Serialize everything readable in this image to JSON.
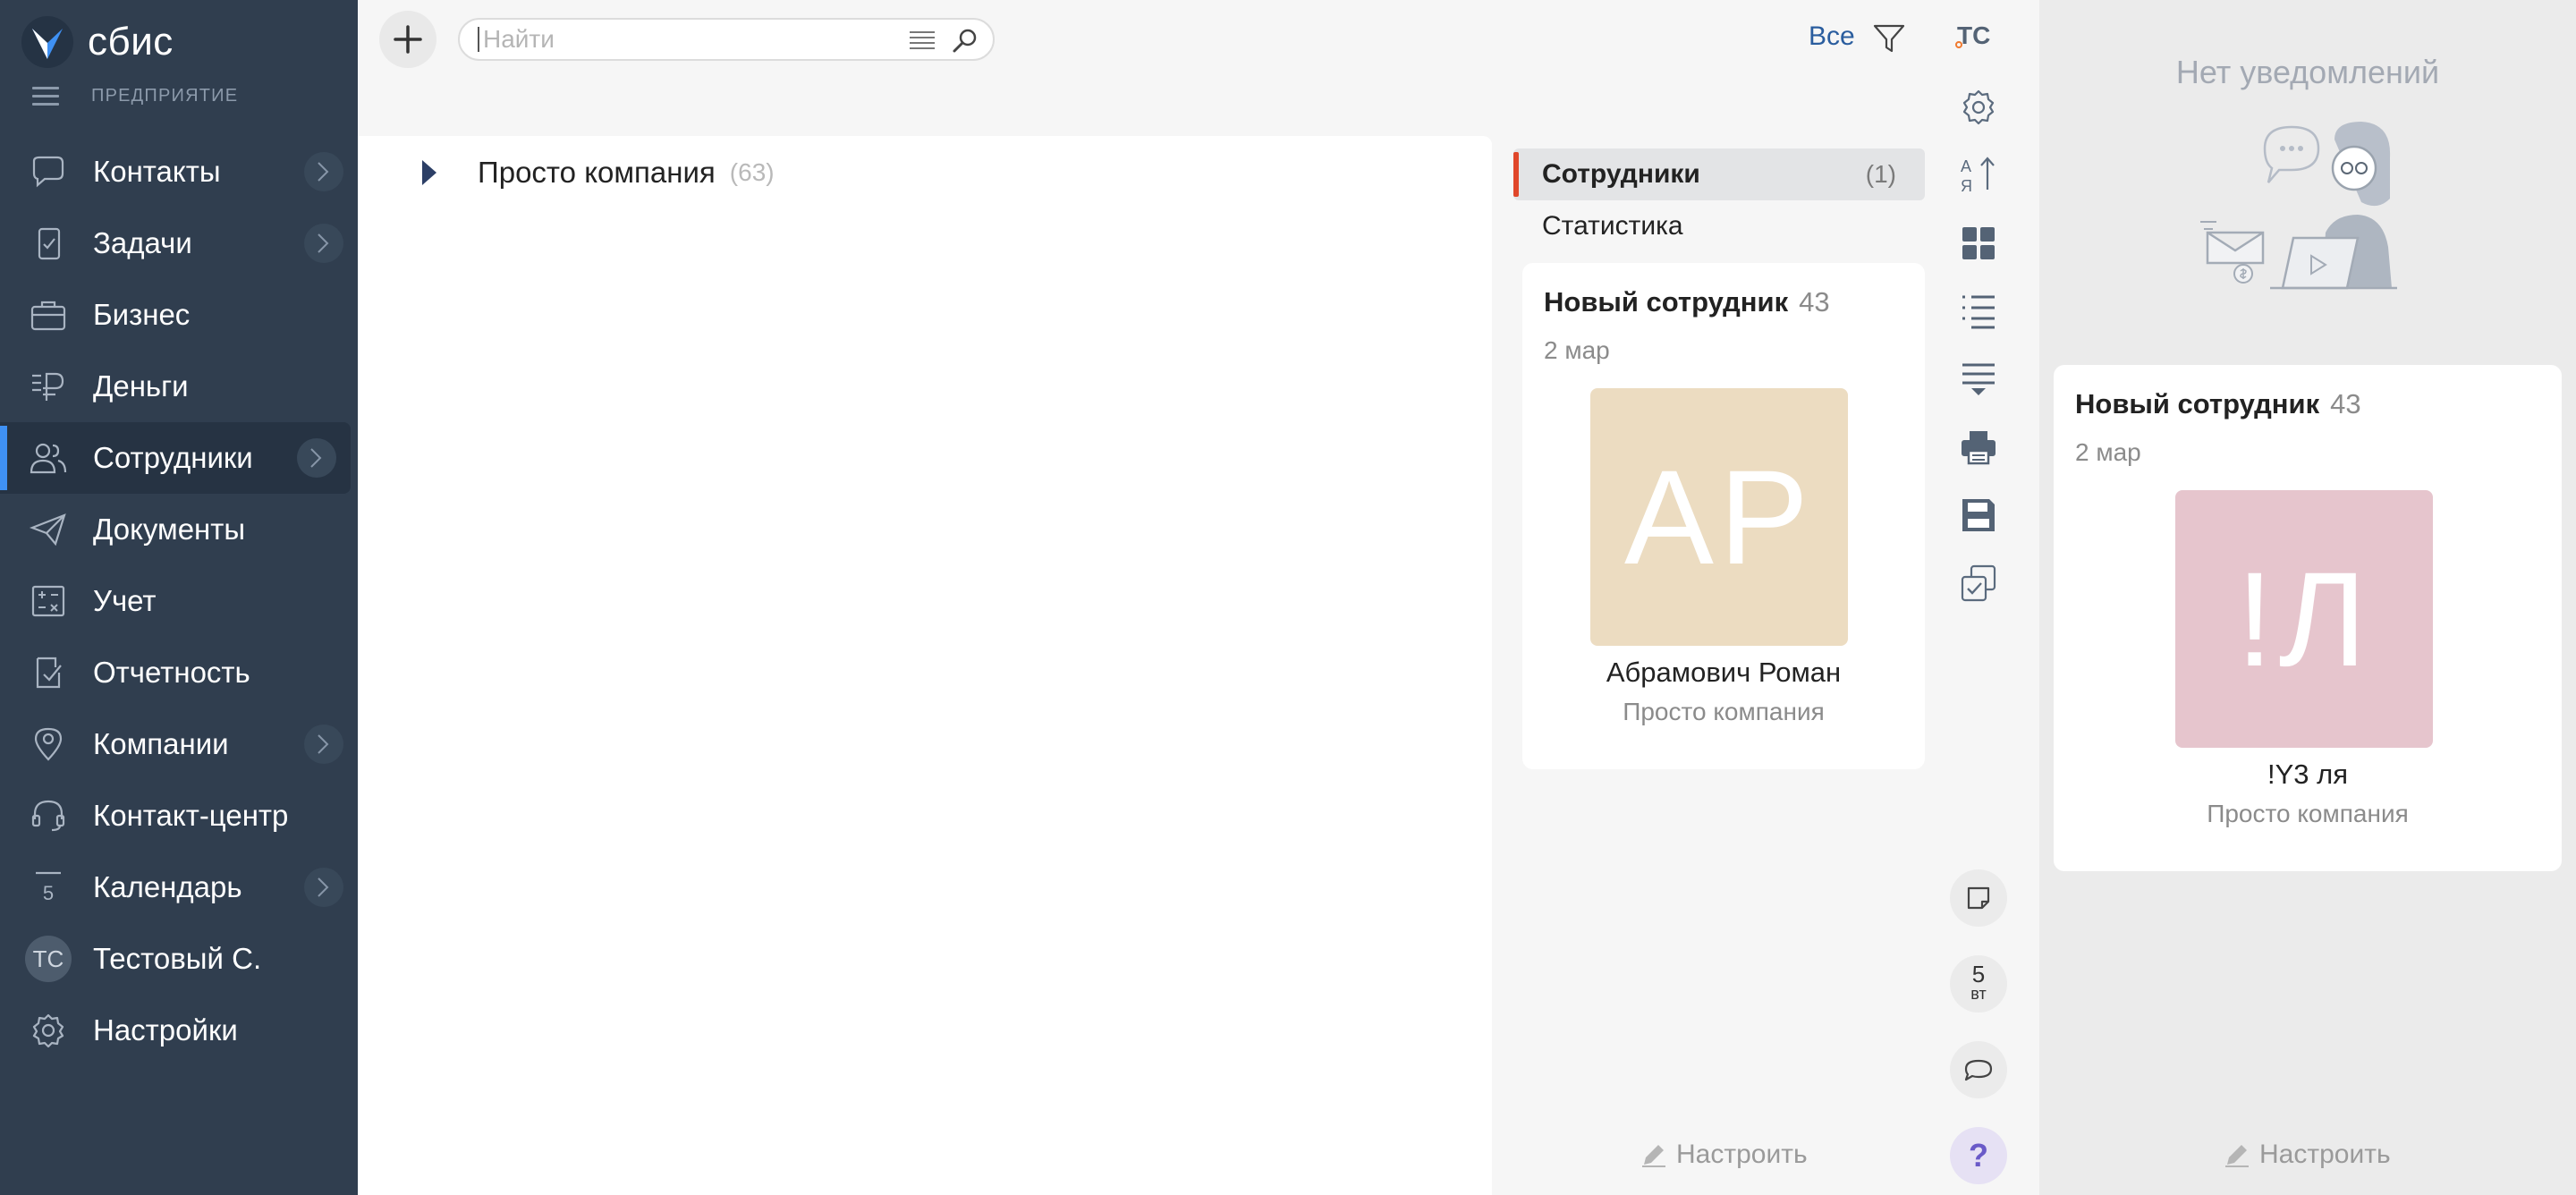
{
  "app": {
    "brand": "сбис",
    "org_label": "ПРЕДПРИЯТИЕ"
  },
  "sidebar": {
    "items": [
      {
        "label": "Контакты",
        "icon": "chat-icon",
        "has_submenu": true
      },
      {
        "label": "Задачи",
        "icon": "task-icon",
        "has_submenu": true
      },
      {
        "label": "Бизнес",
        "icon": "briefcase-icon",
        "has_submenu": false
      },
      {
        "label": "Деньги",
        "icon": "money-icon",
        "has_submenu": false
      },
      {
        "label": "Сотрудники",
        "icon": "people-icon",
        "has_submenu": true,
        "active": true
      },
      {
        "label": "Документы",
        "icon": "paper-plane-icon",
        "has_submenu": false
      },
      {
        "label": "Учет",
        "icon": "calculator-icon",
        "has_submenu": false
      },
      {
        "label": "Отчетность",
        "icon": "report-icon",
        "has_submenu": false
      },
      {
        "label": "Компании",
        "icon": "location-icon",
        "has_submenu": true
      },
      {
        "label": "Контакт-центр",
        "icon": "headset-icon",
        "has_submenu": false
      },
      {
        "label": "Календарь",
        "icon": "calendar-icon",
        "has_submenu": true,
        "calendar_day": "5"
      },
      {
        "label": "Тестовый С.",
        "icon": "avatar",
        "has_submenu": false,
        "initials": "ТС"
      },
      {
        "label": "Настройки",
        "icon": "gear-icon",
        "has_submenu": false
      }
    ]
  },
  "toolbar": {
    "search_placeholder": "Найти",
    "filter_label": "Все",
    "user_initials": "ТС"
  },
  "list": {
    "rows": [
      {
        "name": "Просто компания",
        "count": "(63)"
      }
    ]
  },
  "tabs": [
    {
      "label": "Сотрудники",
      "count": "(1)",
      "active": true
    },
    {
      "label": "Статистика",
      "count": "",
      "active": false
    }
  ],
  "new_employee_card": {
    "title": "Новый сотрудник",
    "count": "43",
    "date": "2 мар",
    "photo_initials": "АР",
    "photo_color": "#ecdcc1",
    "name": "Абрамович Роман",
    "org": "Просто компания"
  },
  "date_button": {
    "day": "5",
    "weekday": "вт"
  },
  "help_label": "?",
  "configure_label": "Настроить",
  "notifications": {
    "empty_title": "Нет уведомлений",
    "card": {
      "title": "Новый сотрудник",
      "count": "43",
      "date": "2 мар",
      "photo_initials": "!Л",
      "photo_color": "#e6c5cd",
      "name": "!Y3 ля",
      "org": "Просто компания"
    },
    "configure_label": "Настроить"
  },
  "colors": {
    "sidebar_bg": "#303e4f",
    "accent_blue": "#3f91f4",
    "accent_red": "#e0472a",
    "link_blue": "#2a5d9e"
  }
}
